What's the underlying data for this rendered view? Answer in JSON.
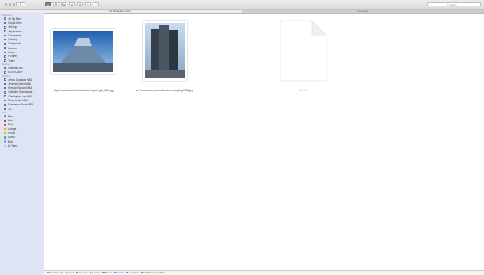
{
  "window": {
    "tab_active": "De Rotterdam 2.html",
    "tab_inactive": "Downloads"
  },
  "toolbar": {
    "view_modes": [
      "⊞",
      "≡",
      "⊟",
      "▤"
    ],
    "arrange_icon": "⊞",
    "action_icon": "⚙",
    "share_icon": "⇪",
    "tag_icon": "○",
    "search_placeholder": "Q Search"
  },
  "sidebar": {
    "favorites_header": "Favorites",
    "favorites": [
      {
        "label": "All My Files",
        "icon": "all-files-icon"
      },
      {
        "label": "iCloud Drive",
        "icon": "cloud-icon"
      },
      {
        "label": "AirDrop",
        "icon": "airdrop-icon"
      },
      {
        "label": "Applications",
        "icon": "applications-icon"
      },
      {
        "label": "Documents",
        "icon": "documents-icon"
      },
      {
        "label": "Desktop",
        "icon": "desktop-icon"
      },
      {
        "label": "Downloads",
        "icon": "downloads-icon"
      },
      {
        "label": "Movies",
        "icon": "movies-icon"
      },
      {
        "label": "Music",
        "icon": "music-icon"
      },
      {
        "label": "Pictures",
        "icon": "pictures-icon"
      },
      {
        "label": "Trash",
        "icon": "trash-icon"
      }
    ],
    "devices_header": "Devices",
    "devices": [
      {
        "label": "Remote Disc",
        "icon": "disc-icon"
      },
      {
        "label": "BOOTCAMP",
        "icon": "drive-icon"
      }
    ],
    "shared_header": "Shared",
    "shared": [
      {
        "label": "Alexis Douglass MBA",
        "icon": "computer-icon"
      },
      {
        "label": "Andrew Cicero MBA",
        "icon": "computer-icon"
      },
      {
        "label": "Brenda Richard MBA",
        "icon": "computer-icon"
      },
      {
        "label": "Christine Greenwood...",
        "icon": "computer-icon"
      },
      {
        "label": "Christopher Lee MBA",
        "icon": "computer-icon"
      },
      {
        "label": "Emily Hulett MBA",
        "icon": "computer-icon"
      },
      {
        "label": "Francesca Stone MBA",
        "icon": "computer-icon"
      },
      {
        "label": "All...",
        "icon": "globe-icon"
      }
    ],
    "tags_header": "Tags",
    "tags": [
      {
        "label": "Blue",
        "color": "#3b82f6"
      },
      {
        "label": "Work",
        "color": "#c2410c"
      },
      {
        "label": "Red",
        "color": "#ef4444"
      },
      {
        "label": "Orange",
        "color": "#f59e0b"
      },
      {
        "label": "Yellow",
        "color": "#eab308"
      },
      {
        "label": "Green",
        "color": "#22c55e"
      },
      {
        "label": "Blue",
        "color": "#60a5fa"
      },
      {
        "label": "All Tags...",
        "color": "#c7c7c7"
      }
    ]
  },
  "files": [
    {
      "name": "http://www.finetuninfo.com/web_imgs/img/1_0801.jpg",
      "tagged": false
    },
    {
      "name": "Premiumcom_fo/merkendelen_img/img/ID51.jpg",
      "tagged": true
    },
    {
      "name": "file.html",
      "tagged": false
    }
  ],
  "pathbar": [
    "Macintosh HD",
    "Users",
    "carleoss",
    "Desktop",
    "Photos",
    "Archive",
    "Lost Dave",
    "De Rotterdam 2.html"
  ]
}
